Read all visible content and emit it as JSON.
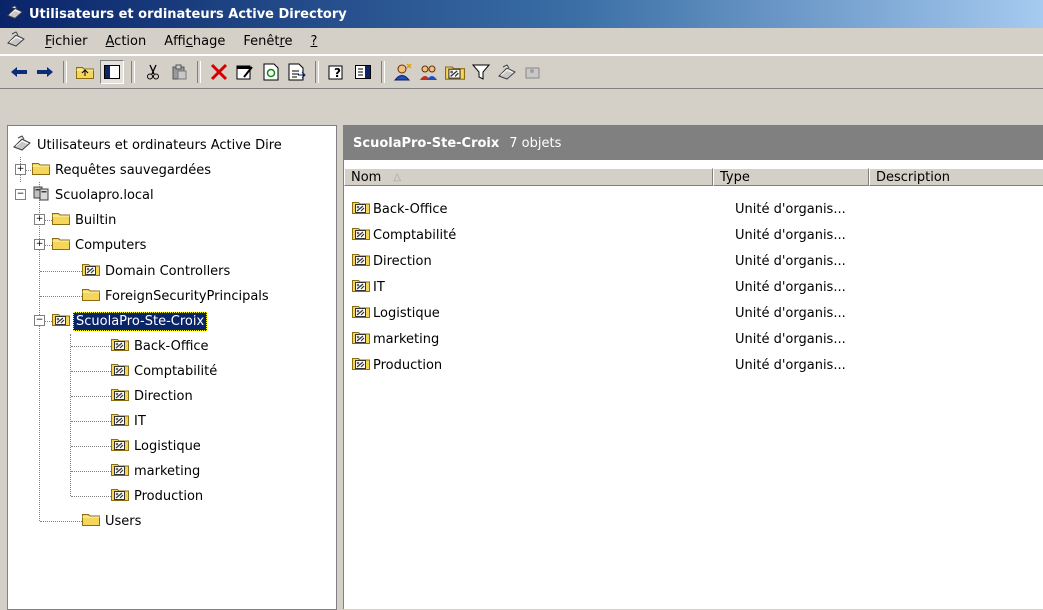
{
  "window": {
    "title": "Utilisateurs et ordinateurs Active Directory"
  },
  "menu": [
    {
      "label": "Fichier",
      "accesskey_index": 0
    },
    {
      "label": "Action",
      "accesskey_index": 0
    },
    {
      "label": "Affichage",
      "accesskey_index": 4
    },
    {
      "label": "Fenêtre",
      "accesskey_index": 5
    },
    {
      "label": "?",
      "accesskey_index": 0
    }
  ],
  "toolbar": {
    "icons": [
      "back-arrow-icon",
      "forward-arrow-icon",
      "up-level-icon",
      "show-hide-tree-icon",
      "cut-icon",
      "paste-icon",
      "delete-icon",
      "properties-icon",
      "refresh-icon",
      "export-list-icon",
      "help-icon",
      "show-hide-action-pane-icon",
      "new-user-icon",
      "new-group-icon",
      "new-ou-icon",
      "filter-icon",
      "find-icon",
      "add-to-group-icon"
    ]
  },
  "tree": {
    "root": "Utilisateurs et ordinateurs Active Dire",
    "saved_queries": "Requêtes sauvegardées",
    "domain": "Scuolapro.local",
    "builtin": "Builtin",
    "computers": "Computers",
    "domain_controllers": "Domain Controllers",
    "foreign": "ForeignSecurityPrincipals",
    "selected_ou": "ScuolaPro-Ste-Croix",
    "children": [
      "Back-Office",
      "Comptabilité",
      "Direction",
      "IT",
      "Logistique",
      "marketing",
      "Production"
    ],
    "users": "Users"
  },
  "details": {
    "container": "ScuolaPro-Ste-Croix",
    "count_text": "7 objets",
    "columns": {
      "name": "Nom",
      "type": "Type",
      "description": "Description"
    },
    "rows": [
      {
        "name": "Back-Office",
        "type": "Unité d'organis..."
      },
      {
        "name": "Comptabilité",
        "type": "Unité d'organis..."
      },
      {
        "name": "Direction",
        "type": "Unité d'organis..."
      },
      {
        "name": "IT",
        "type": "Unité d'organis..."
      },
      {
        "name": "Logistique",
        "type": "Unité d'organis..."
      },
      {
        "name": "marketing",
        "type": "Unité d'organis..."
      },
      {
        "name": "Production",
        "type": "Unité d'organis..."
      }
    ]
  },
  "colors": {
    "title_start": "#0a246a",
    "title_end": "#a6caf0",
    "selection": "#0a246a",
    "header_bar": "#808080"
  }
}
